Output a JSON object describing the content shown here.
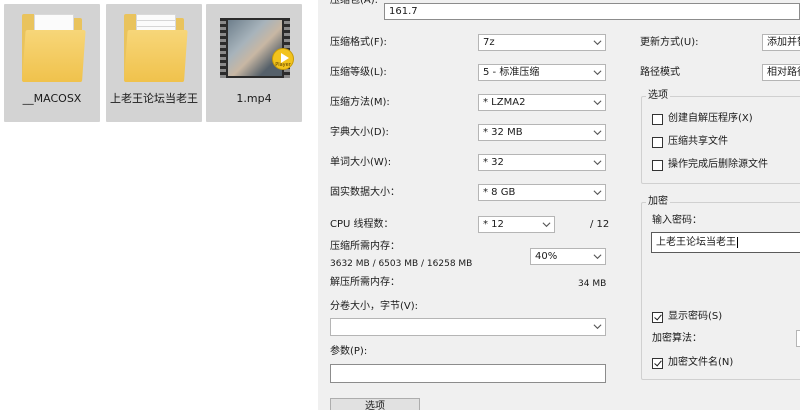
{
  "explorer": {
    "files": [
      {
        "name": "__MACOSX",
        "type": "folder-icon"
      },
      {
        "name": "上老王论坛当老王",
        "type": "folder-icon"
      },
      {
        "name": "1.mp4",
        "type": "video-icon",
        "badge": "Player"
      }
    ]
  },
  "dialog": {
    "archive_label": "压缩包(A):",
    "archive_value": "161.7",
    "format": {
      "label": "压缩格式(F):",
      "value": "7z"
    },
    "level": {
      "label": "压缩等级(L):",
      "value": "5 - 标准压缩"
    },
    "method": {
      "label": "压缩方法(M):",
      "value": "* LZMA2"
    },
    "dict": {
      "label": "字典大小(D):",
      "value": "* 32 MB"
    },
    "word": {
      "label": "单词大小(W):",
      "value": "* 32"
    },
    "solid": {
      "label": "固实数据大小：",
      "value": "* 8 GB"
    },
    "cpu": {
      "label": "CPU 线程数：",
      "value": "* 12",
      "max": "/ 12"
    },
    "mem_compress": {
      "label": "压缩所需内存：",
      "detail": "3632 MB / 6503 MB / 16258 MB",
      "percent": "40%"
    },
    "mem_decompress": {
      "label": "解压所需内存：",
      "value": "34 MB"
    },
    "split": {
      "label": "分卷大小，字节(V):",
      "value": ""
    },
    "params": {
      "label": "参数(P):",
      "value": ""
    },
    "options_button": "选项",
    "update": {
      "label": "更新方式(U):",
      "value": "添加并替"
    },
    "path": {
      "label": "路径模式",
      "value": "相对路径"
    },
    "options_group": {
      "title": "选项",
      "items": [
        {
          "label": "创建自解压程序(X)",
          "checked": false
        },
        {
          "label": "压缩共享文件",
          "checked": false
        },
        {
          "label": "操作完成后删除源文件",
          "checked": false
        }
      ]
    },
    "encryption": {
      "title": "加密",
      "password_label": "输入密码：",
      "password_value": "上老王论坛当老王",
      "show_password": {
        "label": "显示密码(S)",
        "checked": true
      },
      "algorithm_label": "加密算法：",
      "encrypt_names": {
        "label": "加密文件名(N)",
        "checked": true
      }
    }
  }
}
